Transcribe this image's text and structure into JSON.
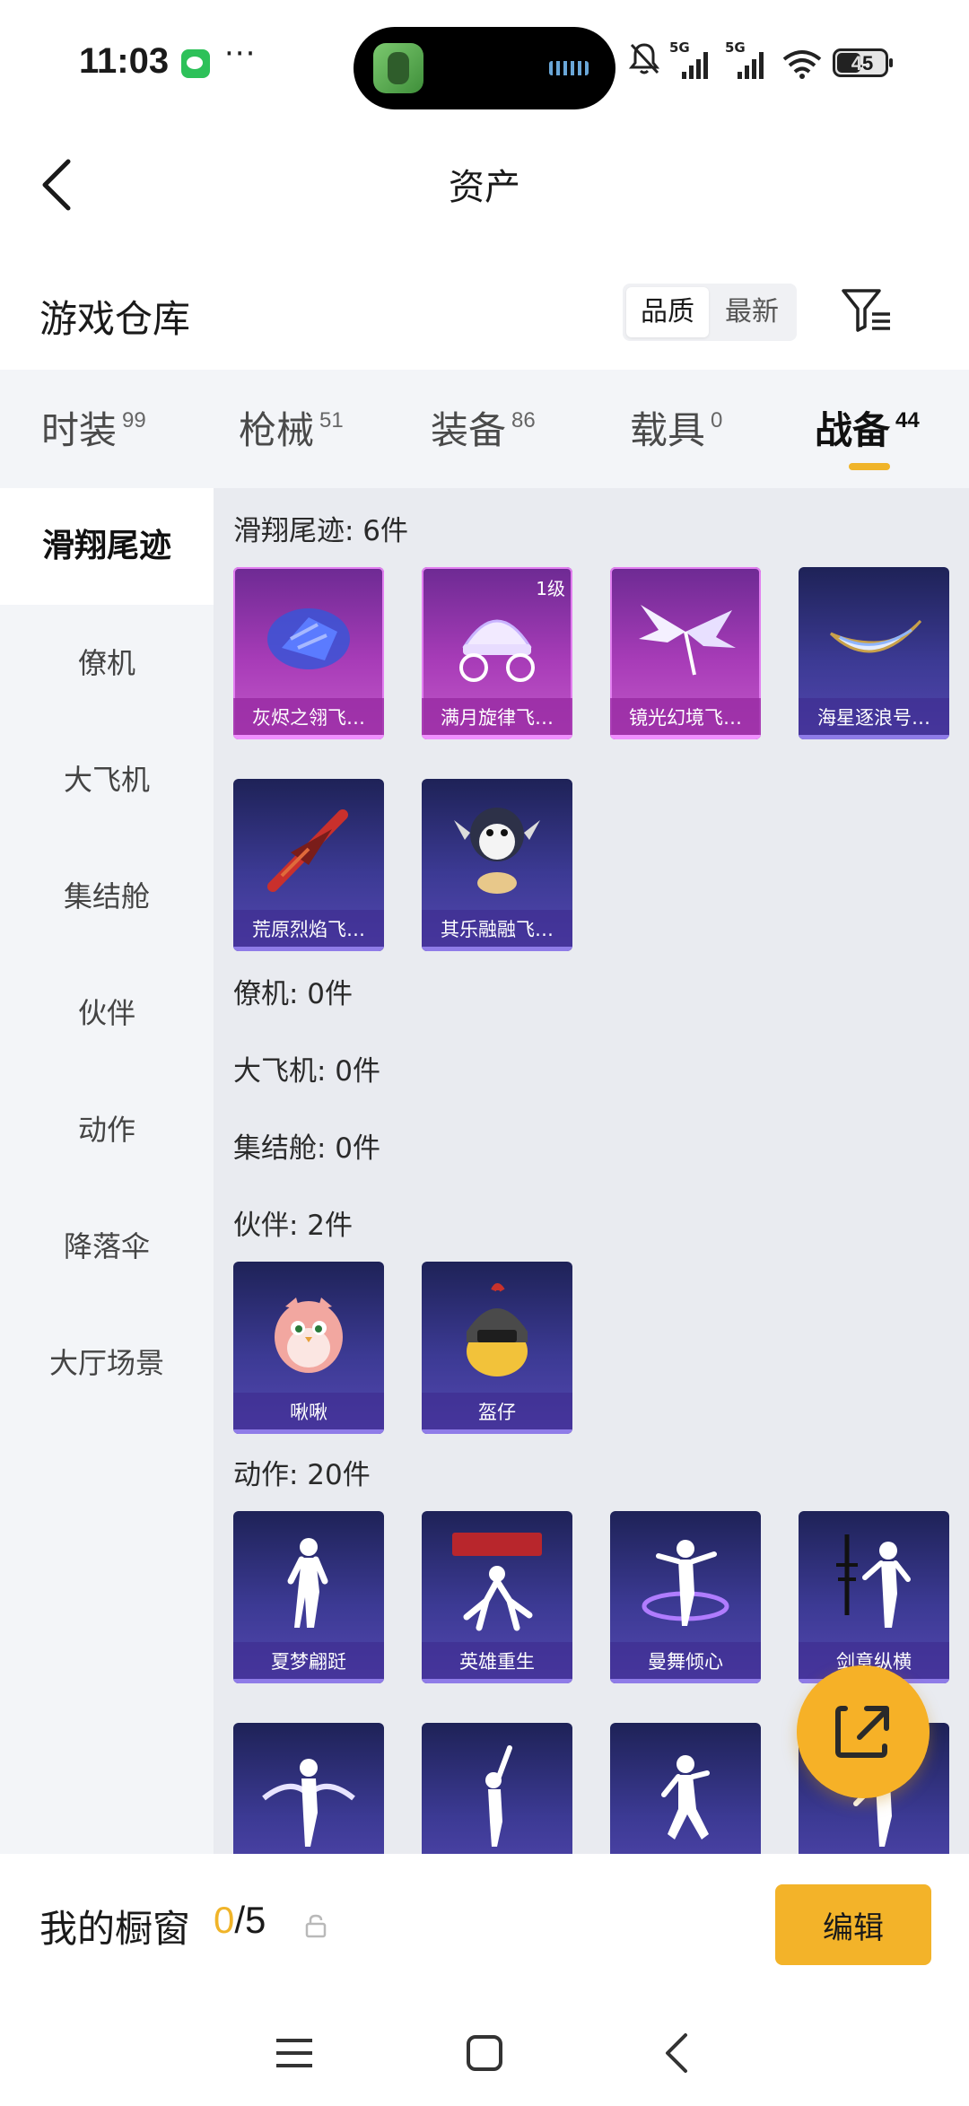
{
  "status_bar": {
    "time": "11:03",
    "dots": "···",
    "battery": "45",
    "network_1": "5G",
    "network_2": "5G",
    "icons": [
      "wechat-icon",
      "game-app-icon",
      "mute-icon",
      "signal-icon",
      "wifi-icon",
      "battery-icon"
    ]
  },
  "header": {
    "title": "资产"
  },
  "warehouse": {
    "title": "游戏仓库",
    "sort_options": [
      "品质",
      "最新"
    ],
    "sort_selected": "品质"
  },
  "tabs": [
    {
      "label": "时装",
      "count": "99"
    },
    {
      "label": "枪械",
      "count": "51"
    },
    {
      "label": "装备",
      "count": "86"
    },
    {
      "label": "载具",
      "count": "0"
    },
    {
      "label": "战备",
      "count": "44",
      "active": true
    }
  ],
  "sidebar": {
    "items": [
      "滑翔尾迹",
      "僚机",
      "大飞机",
      "集结舱",
      "伙伴",
      "动作",
      "降落伞",
      "大厅场景"
    ],
    "active": "滑翔尾迹"
  },
  "sections": [
    {
      "title": "滑翔尾迹: 6件",
      "items": [
        {
          "name": "灰烬之翎飞…",
          "style": "pink"
        },
        {
          "name": "满月旋律飞…",
          "style": "pink",
          "badge": "1级"
        },
        {
          "name": "镜光幻境飞…",
          "style": "pink"
        },
        {
          "name": "海星逐浪号…",
          "style": "dark"
        },
        {
          "name": "荒原烈焰飞…",
          "style": "dark"
        },
        {
          "name": "其乐融融飞…",
          "style": "dark"
        }
      ]
    },
    {
      "title": "僚机: 0件",
      "items": []
    },
    {
      "title": "大飞机: 0件",
      "items": []
    },
    {
      "title": "集结舱: 0件",
      "items": []
    },
    {
      "title": "伙伴: 2件",
      "items": [
        {
          "name": "啾啾",
          "style": "dark"
        },
        {
          "name": "盔仔",
          "style": "dark"
        }
      ]
    },
    {
      "title": "动作: 20件",
      "items": [
        {
          "name": "夏梦翩跹",
          "style": "dark"
        },
        {
          "name": "英雄重生",
          "style": "dark"
        },
        {
          "name": "曼舞倾心",
          "style": "dark"
        },
        {
          "name": "剑意纵横",
          "style": "dark"
        }
      ]
    }
  ],
  "showcase": {
    "label": "我的橱窗",
    "current": "0",
    "total": "/5",
    "edit_label": "编辑"
  },
  "colors": {
    "accent": "#f3b329",
    "tab_indicator": "#f0b429",
    "page_bg": "#e9ebf0",
    "sidebar_bg": "#f3f5f8",
    "card_purple": "#5c4ab8",
    "card_pink": "#a83cb8"
  }
}
